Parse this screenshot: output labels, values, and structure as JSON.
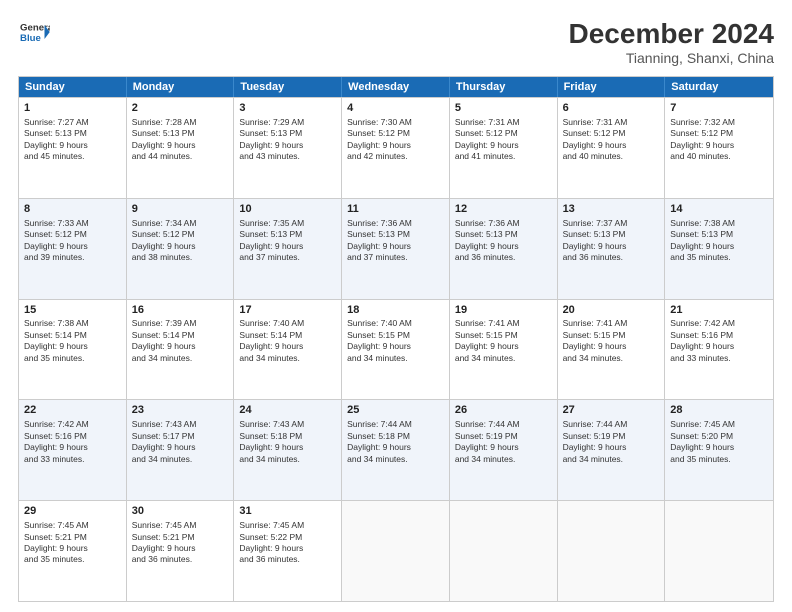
{
  "header": {
    "logo_line1": "General",
    "logo_line2": "Blue",
    "title": "December 2024",
    "subtitle": "Tianning, Shanxi, China"
  },
  "days_of_week": [
    "Sunday",
    "Monday",
    "Tuesday",
    "Wednesday",
    "Thursday",
    "Friday",
    "Saturday"
  ],
  "weeks": [
    [
      {
        "day": 1,
        "lines": [
          "Sunrise: 7:27 AM",
          "Sunset: 5:13 PM",
          "Daylight: 9 hours",
          "and 45 minutes."
        ]
      },
      {
        "day": 2,
        "lines": [
          "Sunrise: 7:28 AM",
          "Sunset: 5:13 PM",
          "Daylight: 9 hours",
          "and 44 minutes."
        ]
      },
      {
        "day": 3,
        "lines": [
          "Sunrise: 7:29 AM",
          "Sunset: 5:13 PM",
          "Daylight: 9 hours",
          "and 43 minutes."
        ]
      },
      {
        "day": 4,
        "lines": [
          "Sunrise: 7:30 AM",
          "Sunset: 5:12 PM",
          "Daylight: 9 hours",
          "and 42 minutes."
        ]
      },
      {
        "day": 5,
        "lines": [
          "Sunrise: 7:31 AM",
          "Sunset: 5:12 PM",
          "Daylight: 9 hours",
          "and 41 minutes."
        ]
      },
      {
        "day": 6,
        "lines": [
          "Sunrise: 7:31 AM",
          "Sunset: 5:12 PM",
          "Daylight: 9 hours",
          "and 40 minutes."
        ]
      },
      {
        "day": 7,
        "lines": [
          "Sunrise: 7:32 AM",
          "Sunset: 5:12 PM",
          "Daylight: 9 hours",
          "and 40 minutes."
        ]
      }
    ],
    [
      {
        "day": 8,
        "lines": [
          "Sunrise: 7:33 AM",
          "Sunset: 5:12 PM",
          "Daylight: 9 hours",
          "and 39 minutes."
        ]
      },
      {
        "day": 9,
        "lines": [
          "Sunrise: 7:34 AM",
          "Sunset: 5:12 PM",
          "Daylight: 9 hours",
          "and 38 minutes."
        ]
      },
      {
        "day": 10,
        "lines": [
          "Sunrise: 7:35 AM",
          "Sunset: 5:13 PM",
          "Daylight: 9 hours",
          "and 37 minutes."
        ]
      },
      {
        "day": 11,
        "lines": [
          "Sunrise: 7:36 AM",
          "Sunset: 5:13 PM",
          "Daylight: 9 hours",
          "and 37 minutes."
        ]
      },
      {
        "day": 12,
        "lines": [
          "Sunrise: 7:36 AM",
          "Sunset: 5:13 PM",
          "Daylight: 9 hours",
          "and 36 minutes."
        ]
      },
      {
        "day": 13,
        "lines": [
          "Sunrise: 7:37 AM",
          "Sunset: 5:13 PM",
          "Daylight: 9 hours",
          "and 36 minutes."
        ]
      },
      {
        "day": 14,
        "lines": [
          "Sunrise: 7:38 AM",
          "Sunset: 5:13 PM",
          "Daylight: 9 hours",
          "and 35 minutes."
        ]
      }
    ],
    [
      {
        "day": 15,
        "lines": [
          "Sunrise: 7:38 AM",
          "Sunset: 5:14 PM",
          "Daylight: 9 hours",
          "and 35 minutes."
        ]
      },
      {
        "day": 16,
        "lines": [
          "Sunrise: 7:39 AM",
          "Sunset: 5:14 PM",
          "Daylight: 9 hours",
          "and 34 minutes."
        ]
      },
      {
        "day": 17,
        "lines": [
          "Sunrise: 7:40 AM",
          "Sunset: 5:14 PM",
          "Daylight: 9 hours",
          "and 34 minutes."
        ]
      },
      {
        "day": 18,
        "lines": [
          "Sunrise: 7:40 AM",
          "Sunset: 5:15 PM",
          "Daylight: 9 hours",
          "and 34 minutes."
        ]
      },
      {
        "day": 19,
        "lines": [
          "Sunrise: 7:41 AM",
          "Sunset: 5:15 PM",
          "Daylight: 9 hours",
          "and 34 minutes."
        ]
      },
      {
        "day": 20,
        "lines": [
          "Sunrise: 7:41 AM",
          "Sunset: 5:15 PM",
          "Daylight: 9 hours",
          "and 34 minutes."
        ]
      },
      {
        "day": 21,
        "lines": [
          "Sunrise: 7:42 AM",
          "Sunset: 5:16 PM",
          "Daylight: 9 hours",
          "and 33 minutes."
        ]
      }
    ],
    [
      {
        "day": 22,
        "lines": [
          "Sunrise: 7:42 AM",
          "Sunset: 5:16 PM",
          "Daylight: 9 hours",
          "and 33 minutes."
        ]
      },
      {
        "day": 23,
        "lines": [
          "Sunrise: 7:43 AM",
          "Sunset: 5:17 PM",
          "Daylight: 9 hours",
          "and 34 minutes."
        ]
      },
      {
        "day": 24,
        "lines": [
          "Sunrise: 7:43 AM",
          "Sunset: 5:18 PM",
          "Daylight: 9 hours",
          "and 34 minutes."
        ]
      },
      {
        "day": 25,
        "lines": [
          "Sunrise: 7:44 AM",
          "Sunset: 5:18 PM",
          "Daylight: 9 hours",
          "and 34 minutes."
        ]
      },
      {
        "day": 26,
        "lines": [
          "Sunrise: 7:44 AM",
          "Sunset: 5:19 PM",
          "Daylight: 9 hours",
          "and 34 minutes."
        ]
      },
      {
        "day": 27,
        "lines": [
          "Sunrise: 7:44 AM",
          "Sunset: 5:19 PM",
          "Daylight: 9 hours",
          "and 34 minutes."
        ]
      },
      {
        "day": 28,
        "lines": [
          "Sunrise: 7:45 AM",
          "Sunset: 5:20 PM",
          "Daylight: 9 hours",
          "and 35 minutes."
        ]
      }
    ],
    [
      {
        "day": 29,
        "lines": [
          "Sunrise: 7:45 AM",
          "Sunset: 5:21 PM",
          "Daylight: 9 hours",
          "and 35 minutes."
        ]
      },
      {
        "day": 30,
        "lines": [
          "Sunrise: 7:45 AM",
          "Sunset: 5:21 PM",
          "Daylight: 9 hours",
          "and 36 minutes."
        ]
      },
      {
        "day": 31,
        "lines": [
          "Sunrise: 7:45 AM",
          "Sunset: 5:22 PM",
          "Daylight: 9 hours",
          "and 36 minutes."
        ]
      },
      null,
      null,
      null,
      null
    ]
  ]
}
